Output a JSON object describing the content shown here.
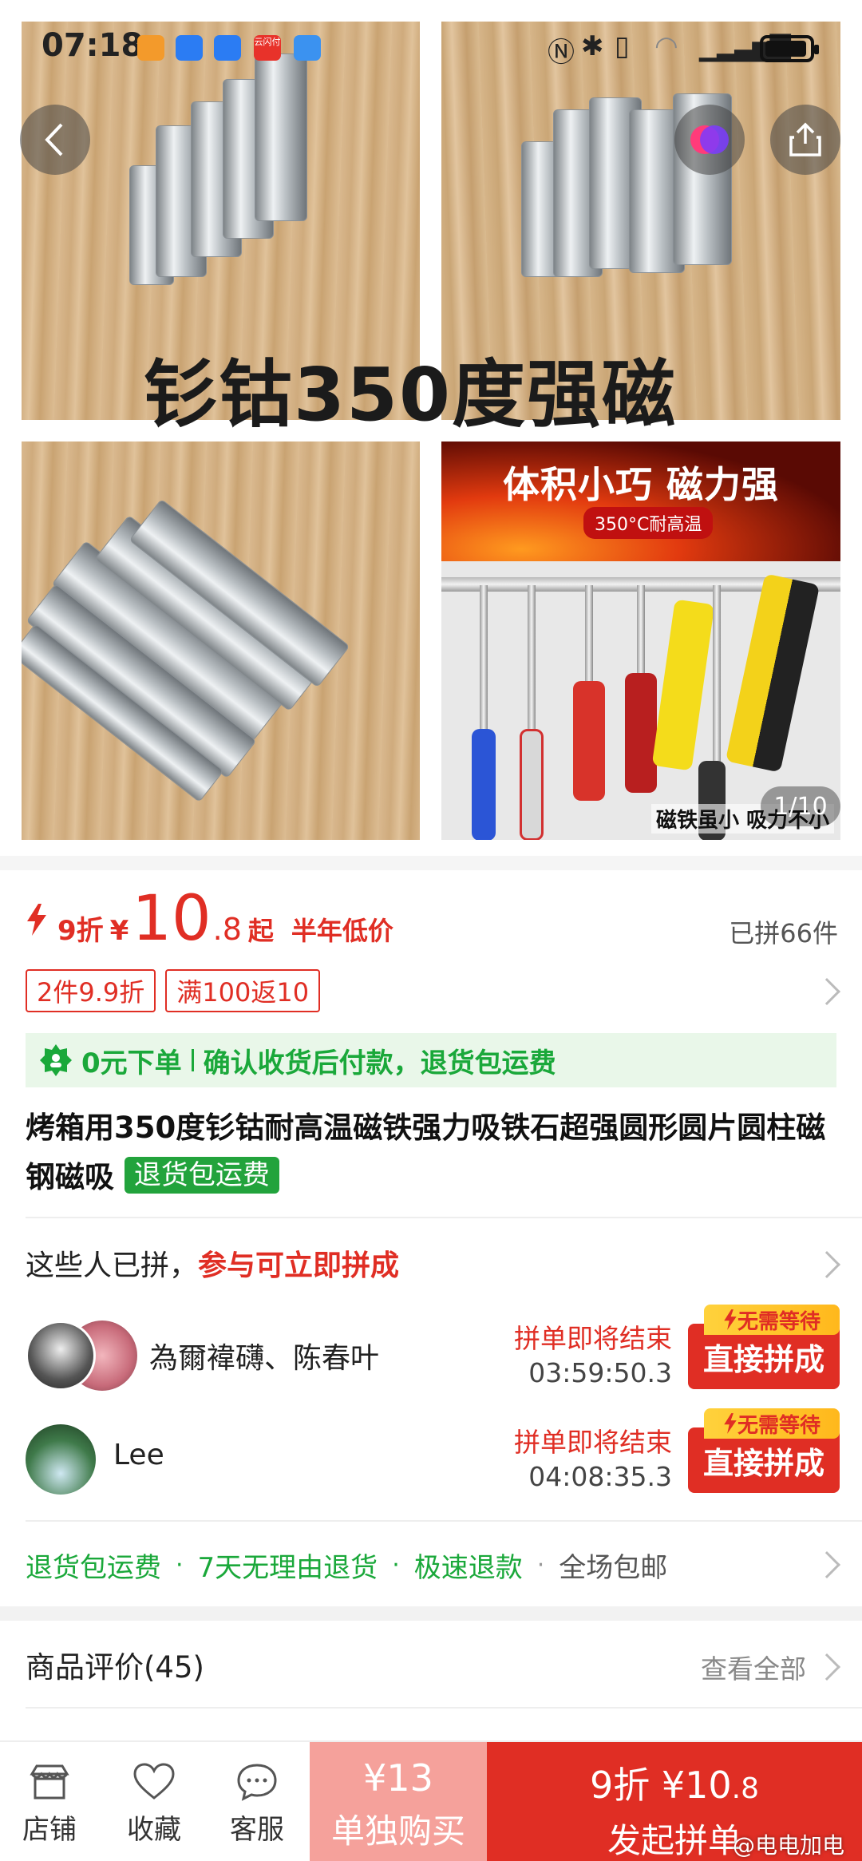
{
  "status_bar": {
    "time": "07:18",
    "app_icon_text": "云闪付"
  },
  "gallery": {
    "banner_text": "钐钴350度强磁",
    "tile4_title": "体积小巧 磁力强",
    "tile4_subtitle": "350°C耐高温",
    "tile4_caption": "磁铁虽小 吸力不小",
    "counter": "1/10"
  },
  "price": {
    "discount": "9折",
    "currency": "¥",
    "integer": "10",
    "decimal": ".8",
    "suffix": "起",
    "low_label": "半年低价",
    "sold": "已拼66件"
  },
  "promo_tags": [
    "2件9.9折",
    "满100返10"
  ],
  "zero_order": {
    "left": "0元下单",
    "right": "确认收货后付款，退货包运费"
  },
  "product": {
    "title": "烤箱用350度钐钴耐高温磁铁强力吸铁石超强圆形圆片圆柱磁钢磁吸",
    "tag": "退货包运费"
  },
  "group_buy": {
    "heading_plain": "这些人已拼，",
    "heading_red": "参与可立即拼成",
    "rows": [
      {
        "name": "為爾褘礴、陈春叶",
        "status": "拼单即将结束",
        "countdown": "03:59:50.3",
        "badge": "无需等待",
        "button": "直接拼成"
      },
      {
        "name": "Lee",
        "status": "拼单即将结束",
        "countdown": "04:08:35.3",
        "badge": "无需等待",
        "button": "直接拼成"
      }
    ]
  },
  "guarantees": [
    "退货包运费",
    "7天无理由退货",
    "极速退款",
    "全场包邮"
  ],
  "reviews": {
    "title": "商品评价(45)",
    "see_all": "查看全部"
  },
  "bottom_bar": {
    "store": "店铺",
    "favorite": "收藏",
    "service": "客服",
    "alone_price": "¥13",
    "alone_label": "单独购买",
    "group_price_discount": "9折",
    "group_price": "¥10",
    "group_price_decimal": ".8",
    "group_label": "发起拼单"
  },
  "watermark": "@电电加电",
  "colors": {
    "accent_red": "#e02e24",
    "green": "#1aa83a",
    "light_red": "#f5a19b"
  }
}
